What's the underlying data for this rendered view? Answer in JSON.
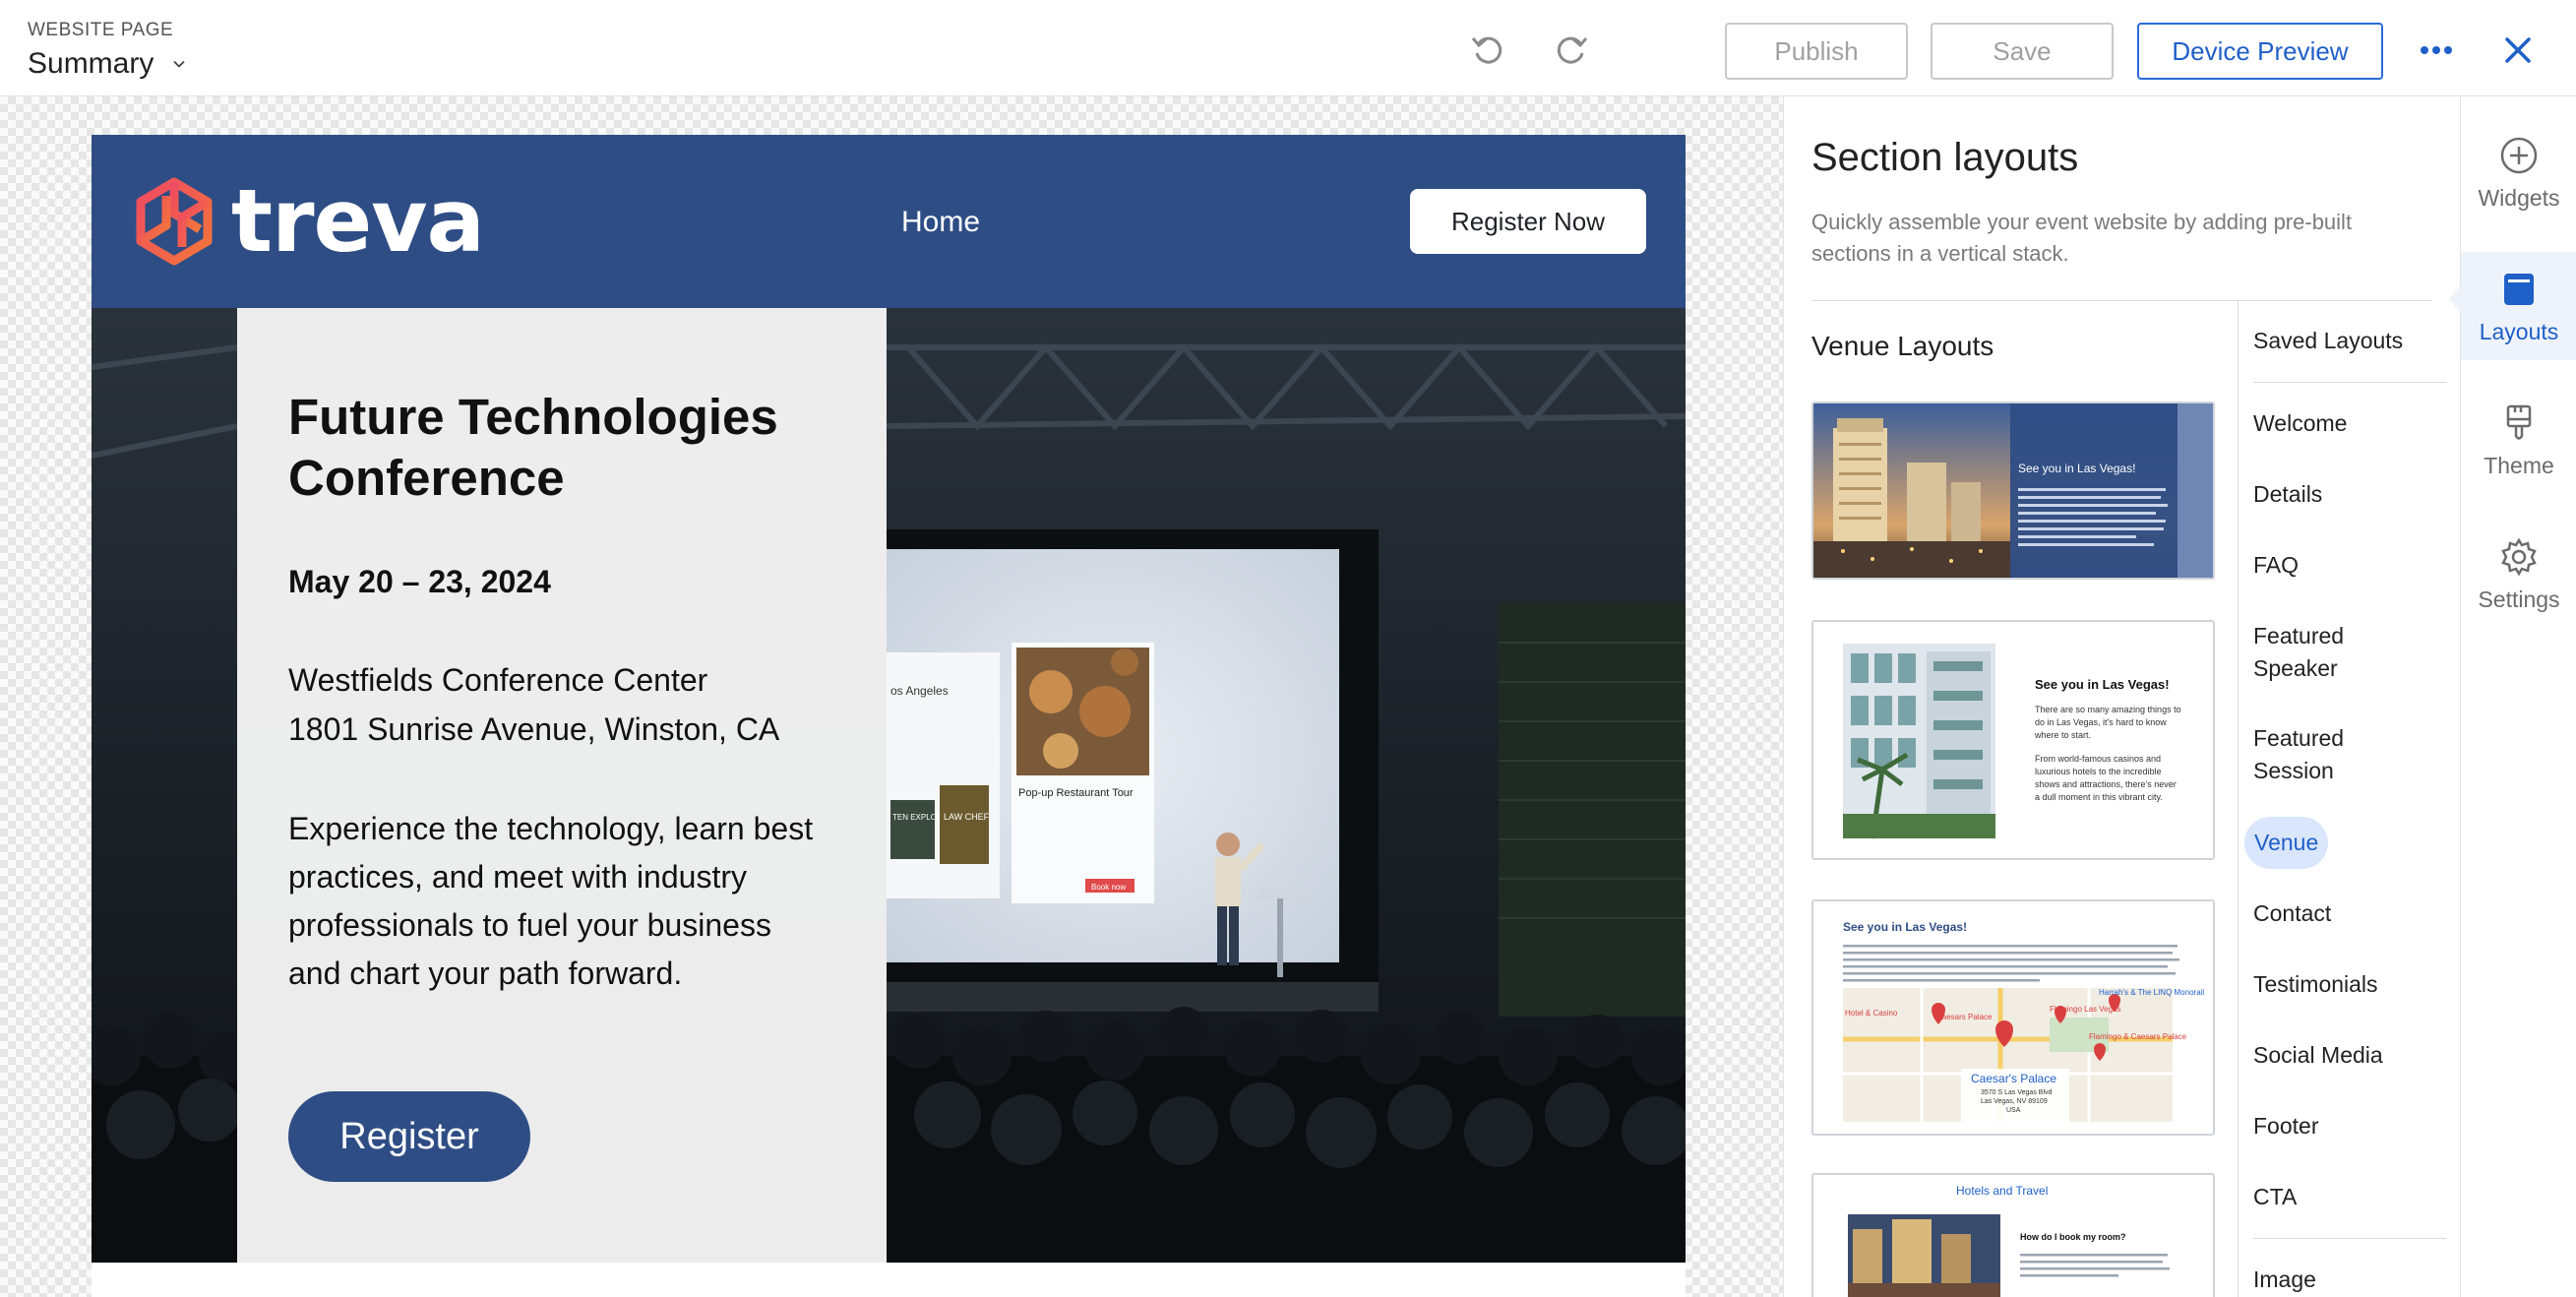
{
  "topbar": {
    "page_kind_label": "WEBSITE PAGE",
    "page_name": "Summary",
    "publish_label": "Publish",
    "save_label": "Save",
    "preview_label": "Device Preview"
  },
  "site": {
    "brand": "treva",
    "nav_home": "Home",
    "register_now_label": "Register Now",
    "hero": {
      "title": "Future Technologies Conference",
      "date": "May 20 – 23, 2024",
      "venue_name": "Westfields Conference Center",
      "venue_address": "1801 Sunrise Avenue, Winston, CA",
      "description": "Experience the technology, learn best practices, and meet with industry professionals to fuel your business and chart your path forward.",
      "register_label": "Register"
    },
    "screen": {
      "city": "os Angeles",
      "card_title": "Pop-up Restaurant Tour",
      "card_button": "Book now",
      "book1": "TEN EXPLORERS",
      "book2": "LAW CHEF"
    }
  },
  "panel": {
    "title": "Section layouts",
    "description": "Quickly assemble your event website by adding pre-built sections in a vertical stack.",
    "group_heading": "Venue Layouts",
    "thumbnails": [
      {
        "heading": "See you in Las Vegas!",
        "body": "There are so many amazing things to do in Las Vegas, it's hard to know where to start. From world-famous casinos and luxurious hotels to the incredible shows and attractions, there's never a dull moment in this vibrant city."
      },
      {
        "heading": "See you in Las Vegas!",
        "body_lines": [
          "There are so many amazing things to",
          "do in Las Vegas, it's hard to know",
          "where to start.",
          "From world-famous casinos and",
          "luxurious hotels to the incredible",
          "shows and attractions, there's never",
          "a dull moment in this vibrant city."
        ]
      },
      {
        "heading": "See you in Las Vegas!",
        "body": "There are so many amazing things to do in Las Vegas. It's hard to know where to start from the world-famous casinos and luxurious hotels to the incredible shows and attractions. Whether you're looking to try your luck at the slot machines or take in a breathtaking performance by a world-renowned artist, Las Vegas has something for everyone. With so much to see and do, Las Vegas is the perfect destination for anyone looking for an unforgettable adventure.",
        "map_labels": [
          "Harrah's & The LINQ Monorail",
          "Caesars Palace",
          "Flamingo Las Vegas",
          "Hotel & Casino",
          "Flamingo & Caesars Palace",
          "Caesar's Palace"
        ],
        "map_address": [
          "3570 S Las Vegas Blvd",
          "Las Vegas, NV 89109",
          "USA"
        ]
      },
      {
        "heading": "Hotels and Travel",
        "question": "How do I book my room?",
        "body": "When you register, you will receive a registration confirmation email with a link to book your room in Paradise by Cvent. You can also book your room from the registration confirmation page."
      }
    ],
    "categories": [
      "Saved Layouts",
      "Welcome",
      "Details",
      "FAQ",
      "Featured Speaker",
      "Featured Session",
      "Venue",
      "Contact",
      "Testimonials",
      "Social Media",
      "Footer",
      "CTA",
      "Image"
    ],
    "active_category": "Venue"
  },
  "rail": {
    "items": [
      {
        "label": "Widgets",
        "icon": "plus-circle-icon"
      },
      {
        "label": "Layouts",
        "icon": "layouts-icon"
      },
      {
        "label": "Theme",
        "icon": "paint-brush-icon"
      },
      {
        "label": "Settings",
        "icon": "gear-icon"
      }
    ],
    "active": "Layouts"
  },
  "colors": {
    "brand_blue": "#2e4d85",
    "accent_blue": "#1f5fc8",
    "logo_gradient": [
      "#e8456b",
      "#f26a3c"
    ]
  }
}
